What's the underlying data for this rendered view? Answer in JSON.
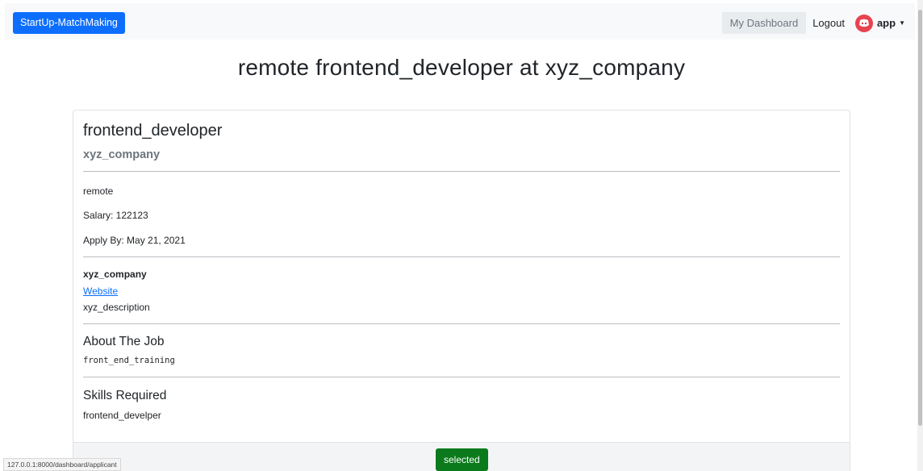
{
  "navbar": {
    "brand": "StartUp-MatchMaking",
    "dashboard": "My Dashboard",
    "logout": "Logout",
    "user": "app",
    "avatar_icon": "discord-avatar-icon",
    "dropdown_icon": "caret-down-icon"
  },
  "page": {
    "title": "remote frontend_developer at xyz_company"
  },
  "job": {
    "title": "frontend_developer",
    "company": "xyz_company",
    "location": "remote",
    "salary": "Salary: 122123",
    "apply_by": "Apply By: May 21, 2021",
    "company_name": "xyz_company",
    "website_link": "Website",
    "company_description": "xyz_description",
    "about_heading": "About The Job",
    "about_text": "front_end_training",
    "skills_heading": "Skills Required",
    "skills_text": "frontend_develper"
  },
  "footer": {
    "status_button": "selected"
  },
  "statusbar": {
    "url": "127.0.0.1:8000/dashboard/applicant"
  },
  "colors": {
    "brand_primary": "#0d6efd",
    "status_selected": "#0b7a1c",
    "avatar": "#e8434f"
  }
}
